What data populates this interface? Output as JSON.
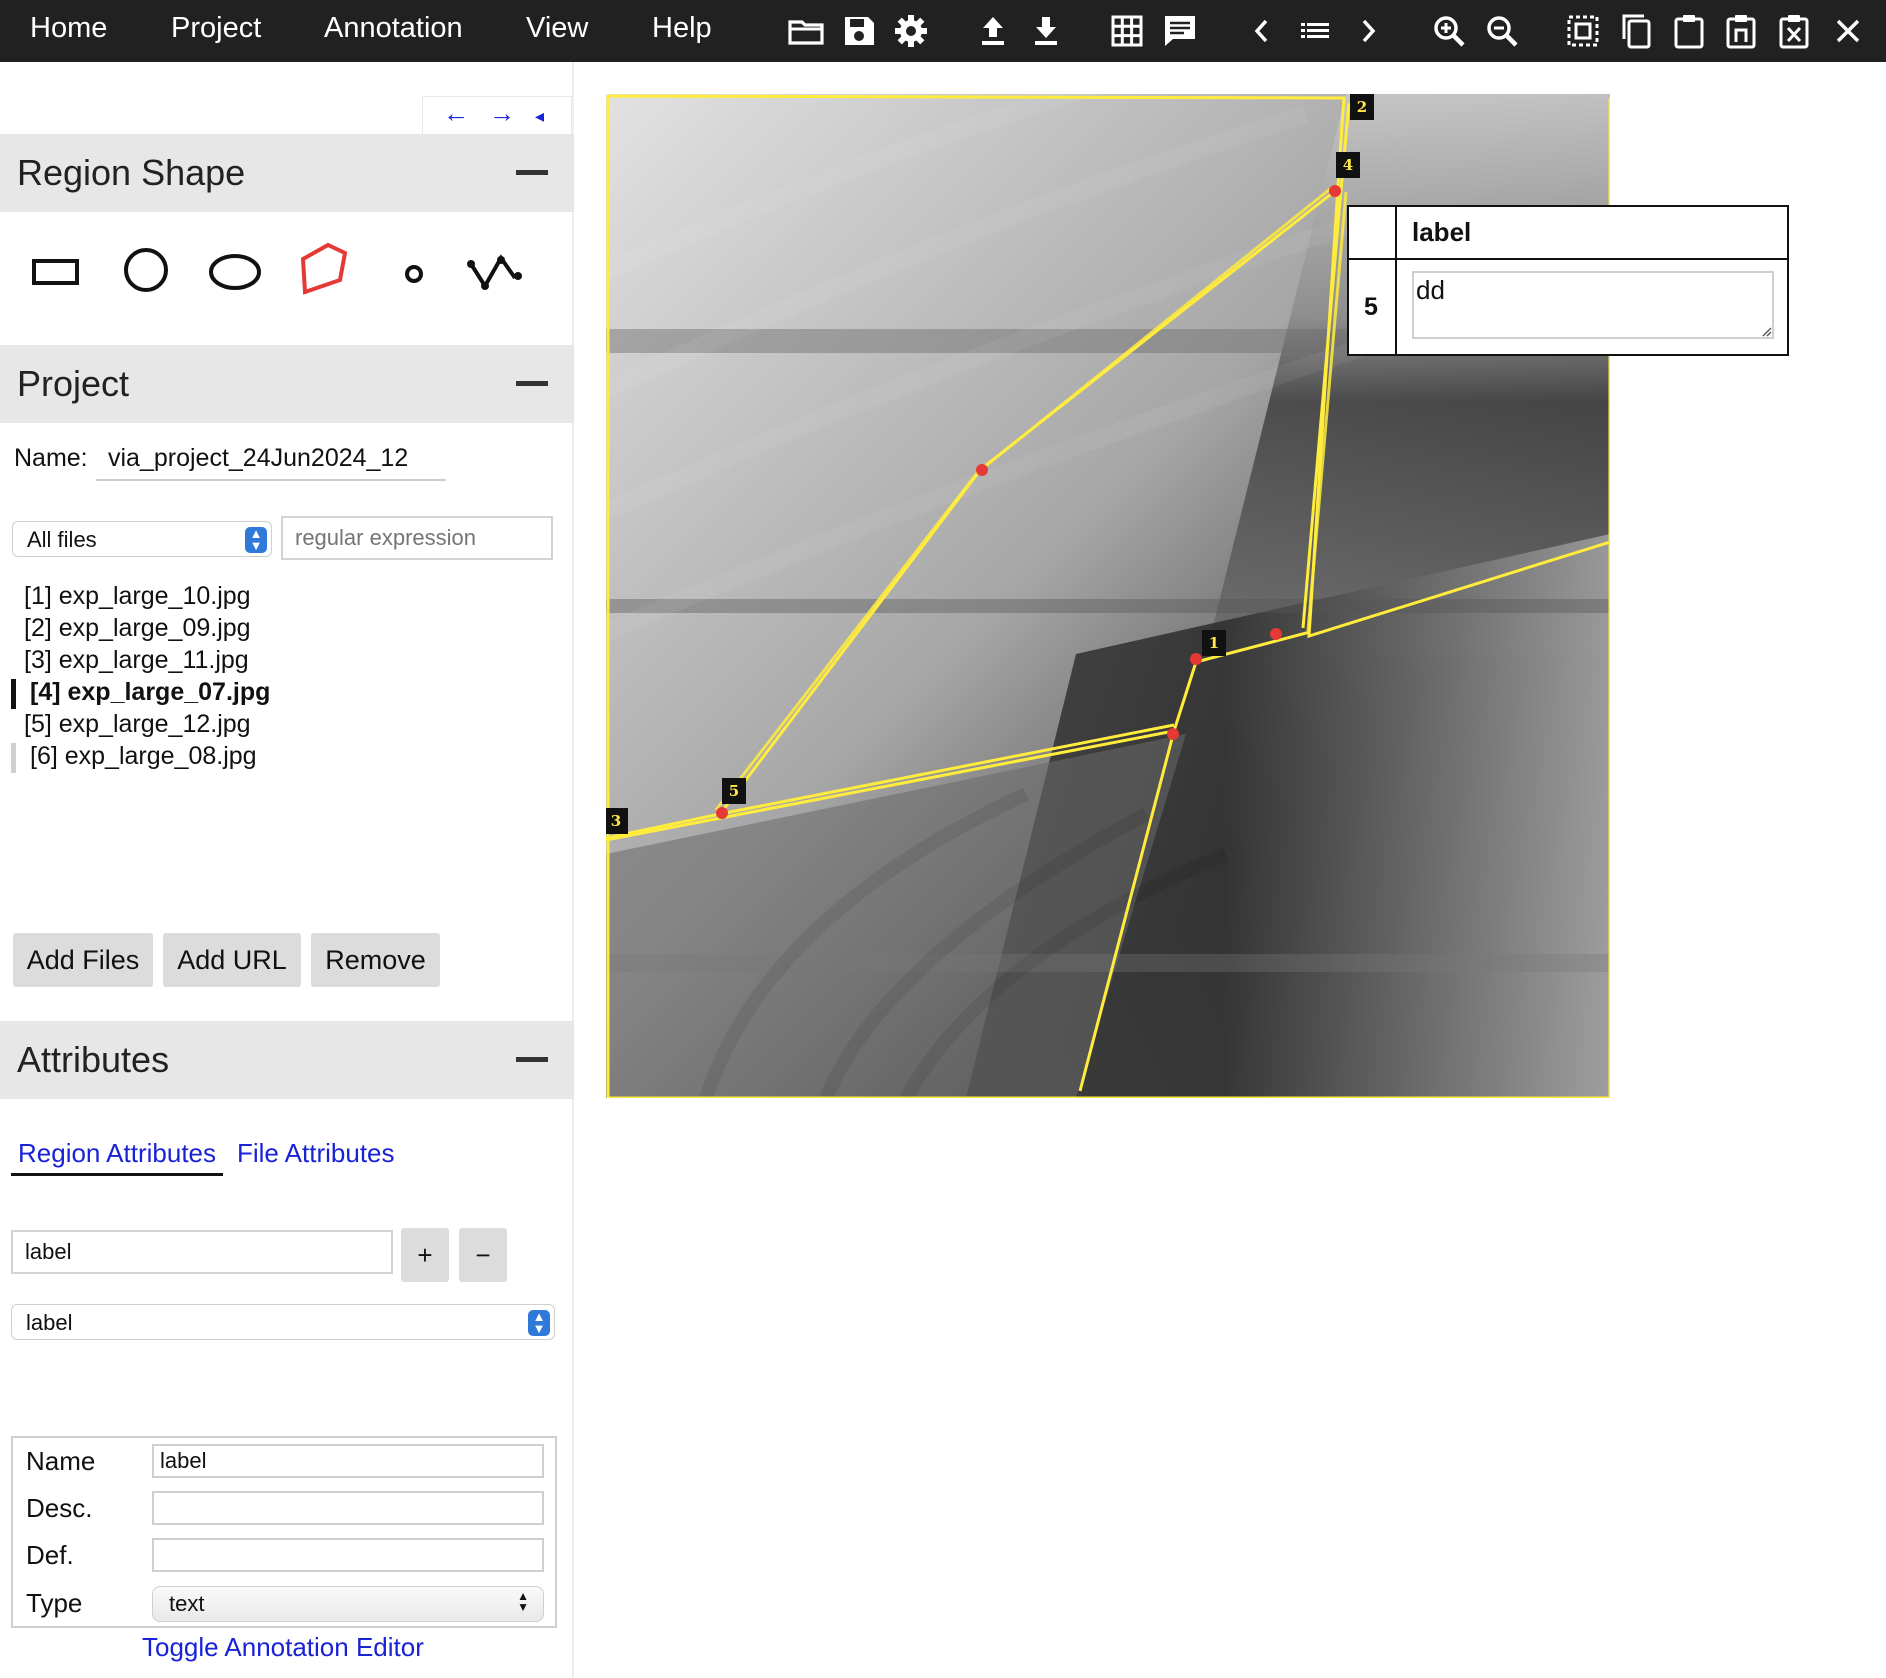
{
  "menu": {
    "items": [
      {
        "label": "Home"
      },
      {
        "label": "Project"
      },
      {
        "label": "Annotation"
      },
      {
        "label": "View"
      },
      {
        "label": "Help"
      }
    ]
  },
  "toolbar_icons": [
    "folder-open-icon",
    "save-icon",
    "settings-icon",
    "upload-icon",
    "download-icon",
    "grid-view-icon",
    "annotation-editor-icon",
    "previous-icon",
    "list-icon",
    "next-icon",
    "zoom-in-icon",
    "zoom-out-icon",
    "select-all-icon",
    "copy-icon",
    "paste-icon",
    "paste-n-icon",
    "delete-icon",
    "close-icon"
  ],
  "nav": {
    "prev": "←",
    "next": "→",
    "collapse": "◂"
  },
  "region_shape": {
    "title": "Region Shape",
    "selected": "polygon"
  },
  "project": {
    "title": "Project",
    "name_label": "Name:",
    "name_value": "via_project_24Jun2024_12",
    "filter_selected": "All files",
    "regex_placeholder": "regular expression",
    "files": [
      {
        "label": "[1] exp_large_10.jpg",
        "state": "normal"
      },
      {
        "label": "[2] exp_large_09.jpg",
        "state": "normal"
      },
      {
        "label": "[3] exp_large_11.jpg",
        "state": "normal"
      },
      {
        "label": "[4] exp_large_07.jpg",
        "state": "current"
      },
      {
        "label": "[5] exp_large_12.jpg",
        "state": "normal"
      },
      {
        "label": "[6] exp_large_08.jpg",
        "state": "marked"
      }
    ],
    "buttons": {
      "add_files": "Add Files",
      "add_url": "Add URL",
      "remove": "Remove"
    }
  },
  "attributes": {
    "title": "Attributes",
    "tabs": {
      "region": "Region Attributes",
      "file": "File Attributes"
    },
    "new_attr_value": "label",
    "add_button": "+",
    "remove_button": "−",
    "attr_selected": "label",
    "fields": {
      "name_label": "Name",
      "name_value": "label",
      "desc_label": "Desc.",
      "desc_value": "",
      "def_label": "Def.",
      "def_value": "",
      "type_label": "Type",
      "type_value": "text"
    },
    "toggle_link": "Toggle Annotation Editor"
  },
  "regions": [
    {
      "id": "1"
    },
    {
      "id": "2"
    },
    {
      "id": "3"
    },
    {
      "id": "4"
    },
    {
      "id": "5"
    }
  ],
  "popup": {
    "header": "label",
    "row_id": "5",
    "value": "dd"
  },
  "colors": {
    "topbar": "#212121",
    "region_outline": "#ffec3d",
    "vertex": "#e53935",
    "link": "#1a22d6",
    "selected_shape": "#e53935"
  }
}
